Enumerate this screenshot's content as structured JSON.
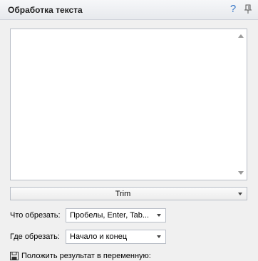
{
  "header": {
    "title": "Обработка текста",
    "help_glyph": "?",
    "help_icon": "question-icon",
    "pin_icon": "pin-icon"
  },
  "text_area": {
    "value": ""
  },
  "action_select": {
    "value": "Trim"
  },
  "what_to_trim": {
    "label": "Что обрезать:",
    "value": "Пробелы, Enter, Tab..."
  },
  "where_to_trim": {
    "label": "Где обрезать:",
    "value": "Начало и конец"
  },
  "save_result": {
    "label": "Положить результат в переменную:",
    "icon": "save-icon"
  },
  "colors": {
    "accent": "#3a78c8",
    "panel": "#f0f0f0",
    "border": "#b9bec7"
  }
}
